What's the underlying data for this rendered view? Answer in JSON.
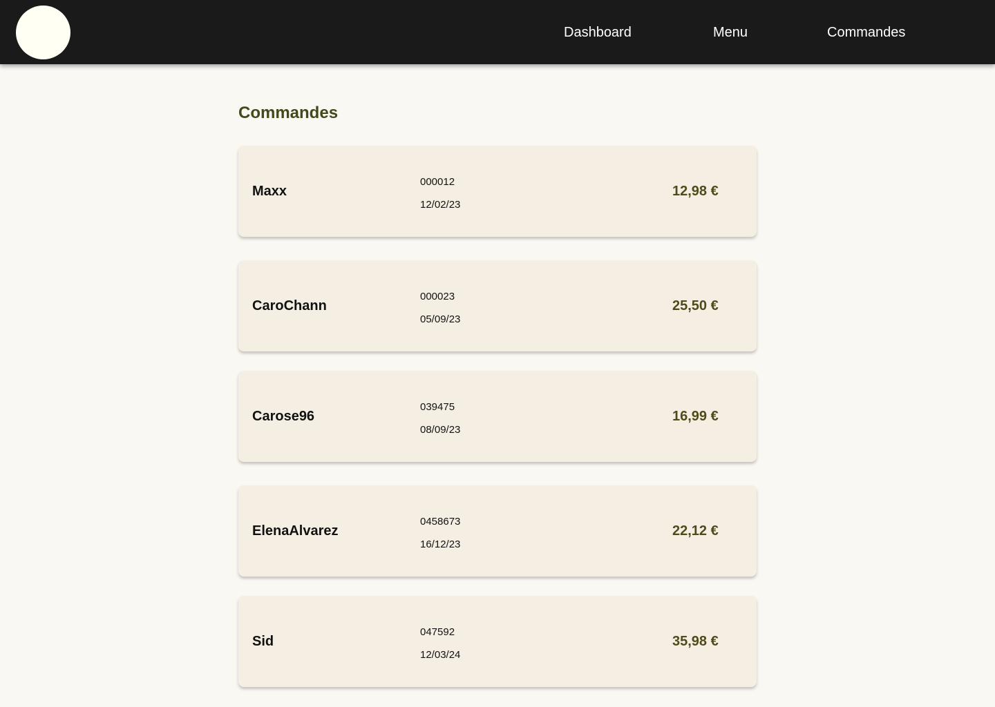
{
  "header": {
    "nav": [
      {
        "label": "Dashboard"
      },
      {
        "label": "Menu"
      },
      {
        "label": "Commandes"
      }
    ]
  },
  "page": {
    "title": "Commandes"
  },
  "orders": [
    {
      "customer": "Maxx",
      "number": "000012",
      "date": "12/02/23",
      "total": "12,98 €"
    },
    {
      "customer": "CaroChann",
      "number": "000023",
      "date": "05/09/23",
      "total": "25,50 €"
    },
    {
      "customer": "Carose96",
      "number": "039475",
      "date": "08/09/23",
      "total": "16,99 €"
    },
    {
      "customer": "ElenaAlvarez",
      "number": "0458673",
      "date": "16/12/23",
      "total": "22,12 €"
    },
    {
      "customer": "Sid",
      "number": "047592",
      "date": "12/03/24",
      "total": "35,98 €"
    }
  ],
  "colors": {
    "header_bg": "#1a1a1a",
    "page_bg": "#faf8f3",
    "card_bg": "#f5efe3",
    "accent": "#44481a",
    "logo": "#fffff4"
  }
}
